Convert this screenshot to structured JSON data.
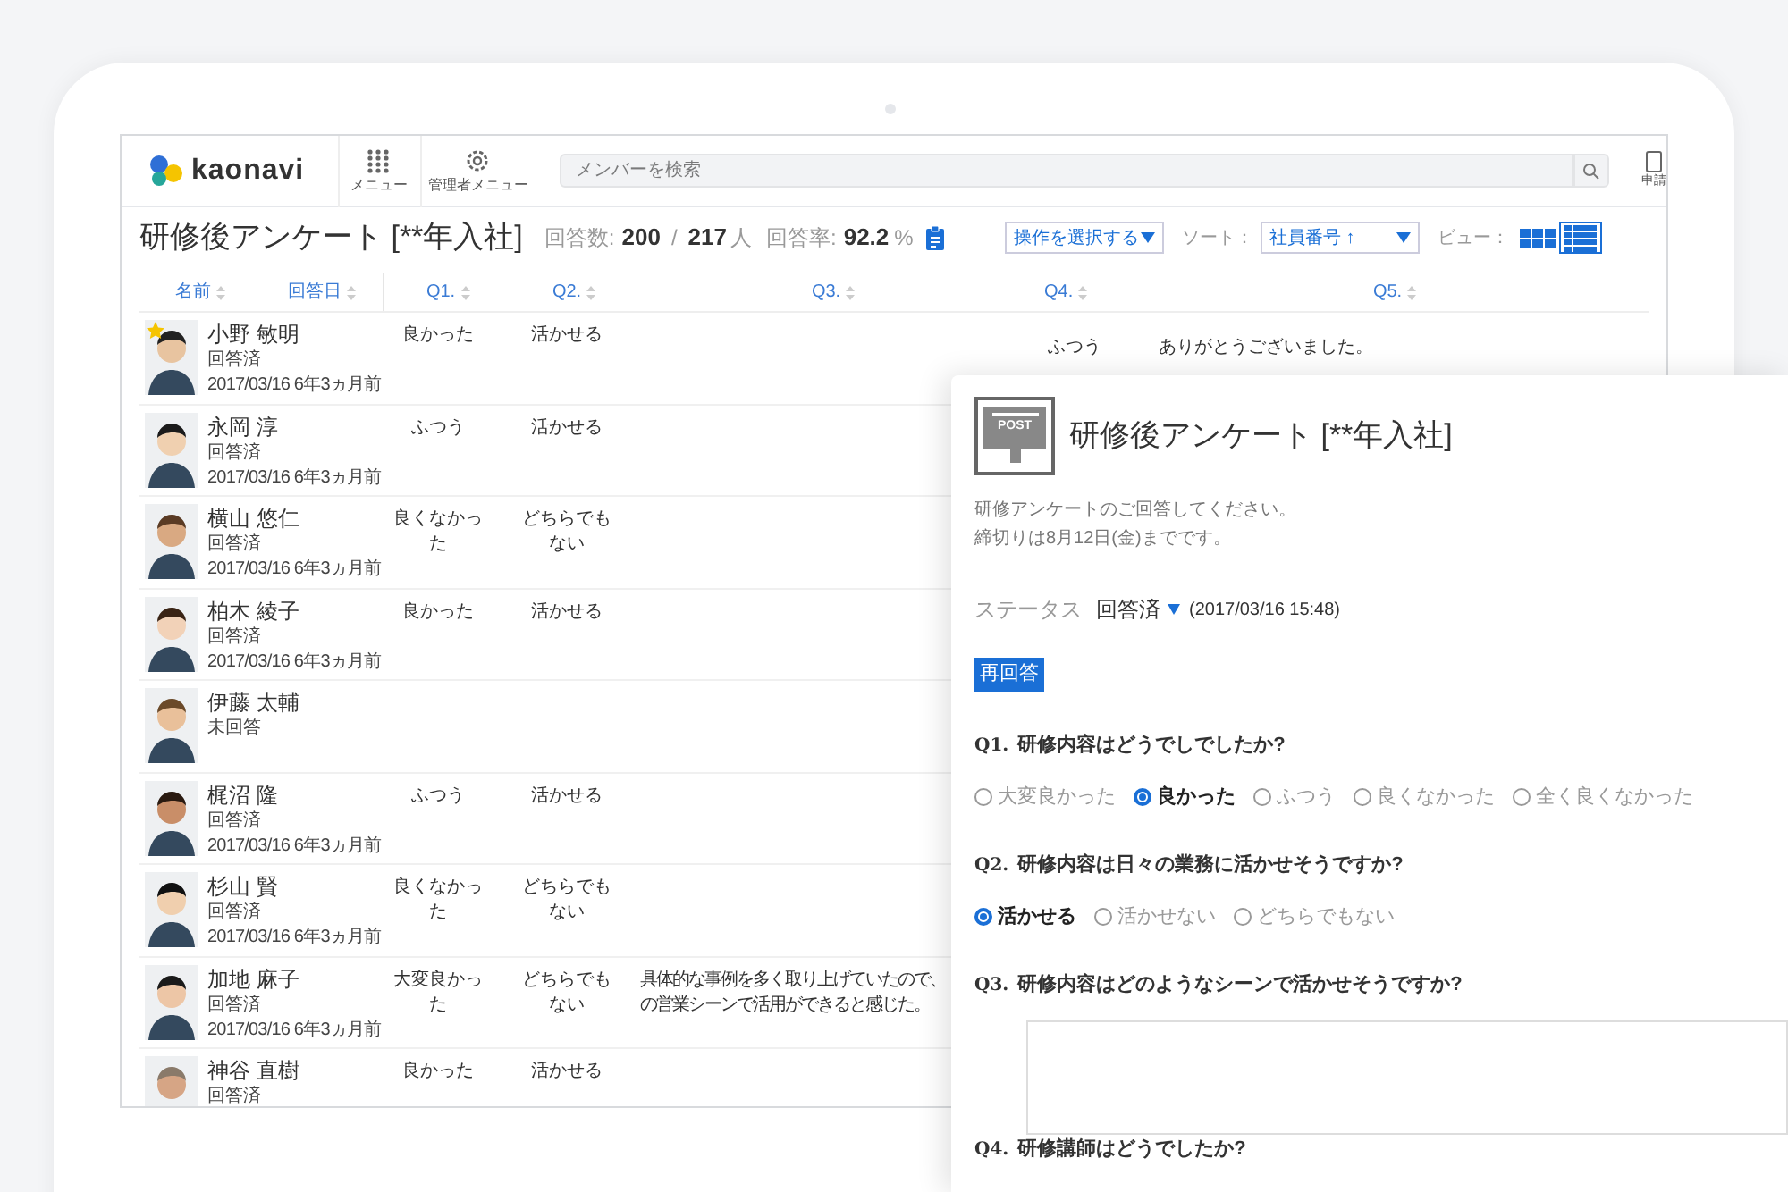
{
  "app": {
    "logo": "kaonavi",
    "nav": [
      {
        "kind": "grid",
        "label": "メニュー"
      },
      {
        "kind": "gear",
        "label": "管理者メニュー"
      }
    ],
    "search": {
      "placeholder": "メンバーを検索"
    },
    "apply": "申請"
  },
  "survey": {
    "title": "研修後アンケート [**年入社]",
    "answers_label": "回答数:",
    "answers": "200",
    "separator": "/",
    "total": "217",
    "unit": "人",
    "rate_label": "回答率:",
    "rate": "92.2",
    "percent": "%"
  },
  "toolbar": {
    "action_select": "操作を選択する",
    "sort_label": "ソート：",
    "sort_select": "社員番号 ↑",
    "view_label": "ビュー：",
    "views": [
      {
        "kind": "grid",
        "selected": false
      },
      {
        "kind": "list",
        "selected": true
      }
    ]
  },
  "table": {
    "columns": [
      "名前",
      "回答日",
      "Q1.",
      "Q2.",
      "Q3.",
      "Q4.",
      "Q5."
    ],
    "rows": [
      {
        "name": "小野 敏明",
        "status": "回答済",
        "date": "2017/03/16 6年3ヵ月前",
        "starred": true,
        "q1": "良かった",
        "q2": "活かせる",
        "q3": [],
        "q4": "ふつう",
        "q5": "ありがとうございました。"
      },
      {
        "name": "永岡 淳",
        "status": "回答済",
        "date": "2017/03/16 6年3ヵ月前",
        "starred": false,
        "q1": "ふつう",
        "q2": "活かせる",
        "q3": []
      },
      {
        "name": "横山 悠仁",
        "status": "回答済",
        "date": "2017/03/16 6年3ヵ月前",
        "starred": false,
        "q1": "良くなかった",
        "q2": "どちらでもない",
        "q3": []
      },
      {
        "name": "柏木 綾子",
        "status": "回答済",
        "date": "2017/03/16 6年3ヵ月前",
        "starred": false,
        "q1": "良かった",
        "q2": "活かせる",
        "q3": []
      },
      {
        "name": "伊藤 太輔",
        "status": "未回答",
        "starred": false,
        "q3": []
      },
      {
        "name": "梶沼 隆",
        "status": "回答済",
        "date": "2017/03/16 6年3ヵ月前",
        "starred": false,
        "q1": "ふつう",
        "q2": "活かせる",
        "q3": []
      },
      {
        "name": "杉山 賢",
        "status": "回答済",
        "date": "2017/03/16 6年3ヵ月前",
        "starred": false,
        "q1": "良くなかった",
        "q2": "どちらでもない",
        "q3": []
      },
      {
        "name": "加地 麻子",
        "status": "回答済",
        "date": "2017/03/16 6年3ヵ月前",
        "starred": false,
        "q1": "大変良かった",
        "q2": "どちらでもない",
        "q3": [
          "具体的な事例を多く取り上げていたので、",
          "の営業シーンで活用ができると感じた。"
        ]
      },
      {
        "name": "神谷 直樹",
        "status": "回答済",
        "starred": false,
        "q1": "良かった",
        "q2": "活かせる",
        "q3": []
      }
    ]
  },
  "panel": {
    "icon_label": "POST",
    "title": "研修後アンケート [**年入社]",
    "description": [
      "研修アンケートのご回答してください。",
      "締切りは8月12日(金)までです。"
    ],
    "status_label": "ステータス",
    "status": "回答済",
    "status_date": "(2017/03/16 15:48)",
    "button": "再回答",
    "questions": [
      {
        "kind": "radio",
        "number": "Q1.",
        "text": "研修内容はどうでしでしたか?",
        "options": [
          {
            "label": "大変良かった",
            "selected": false
          },
          {
            "label": "良かった",
            "selected": true
          },
          {
            "label": "ふつう",
            "selected": false
          },
          {
            "label": "良くなかった",
            "selected": false
          },
          {
            "label": "全く良くなかった",
            "selected": false
          }
        ]
      },
      {
        "kind": "radio",
        "number": "Q2.",
        "text": "研修内容は日々の業務に活かせそうですか?",
        "options": [
          {
            "label": "活かせる",
            "selected": true
          },
          {
            "label": "活かせない",
            "selected": false
          },
          {
            "label": "どちらでもない",
            "selected": false
          }
        ]
      },
      {
        "kind": "text",
        "number": "Q3.",
        "text": "研修内容はどのようなシーンで活かせそうですか?"
      },
      {
        "kind": "radio",
        "number": "Q4.",
        "text": "研修講師はどうでしたか?"
      }
    ]
  }
}
